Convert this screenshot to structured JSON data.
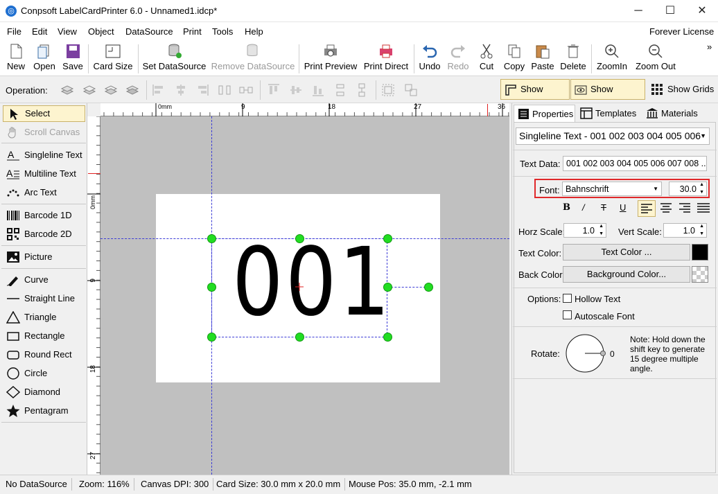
{
  "window": {
    "title": "Conpsoft LabelCardPrinter 6.0 - Unnamed1.idcp*",
    "minimize": "─",
    "maximize": "☐",
    "close": "✕"
  },
  "menu": {
    "items": [
      "File",
      "Edit",
      "View",
      "Object",
      "DataSource",
      "Print",
      "Tools",
      "Help"
    ],
    "license": "Forever License"
  },
  "toolbar": {
    "new": "New",
    "open": "Open",
    "save": "Save",
    "card_size": "Card Size",
    "set_ds": "Set DataSource",
    "remove_ds": "Remove DataSource",
    "print_preview": "Print Preview",
    "print_direct": "Print Direct",
    "undo": "Undo",
    "redo": "Redo",
    "cut": "Cut",
    "copy": "Copy",
    "paste": "Paste",
    "delete": "Delete",
    "zoom_in": "ZoomIn",
    "zoom_out": "Zoom Out",
    "overflow": "»"
  },
  "opbar": {
    "label": "Operation:",
    "show_ruler": "Show Ruler",
    "show_guides": "Show Guides",
    "show_grids": "Show Grids"
  },
  "tools": {
    "select": "Select",
    "scroll": "Scroll Canvas",
    "single": "Singleline Text",
    "multi": "Multiline Text",
    "arc": "Arc Text",
    "bc1": "Barcode 1D",
    "bc2": "Barcode 2D",
    "picture": "Picture",
    "curve": "Curve",
    "line": "Straight Line",
    "triangle": "Triangle",
    "rectangle": "Rectangle",
    "roundrect": "Round Rect",
    "circle": "Circle",
    "diamond": "Diamond",
    "pentagram": "Pentagram"
  },
  "ruler": {
    "h": [
      "0mm",
      "9",
      "18",
      "27",
      "36"
    ],
    "v": [
      "0mm",
      "9",
      "18",
      "27"
    ]
  },
  "canvas": {
    "text": "001"
  },
  "panel": {
    "tabs": {
      "properties": "Properties",
      "templates": "Templates",
      "materials": "Materials"
    },
    "object_select": "Singleline Text - 001 002 003 004 005 006",
    "text_data_label": "Text Data:",
    "text_data": "001 002 003 004 005 006 007 008 ...",
    "font_label": "Font:",
    "font": "Bahnschrift",
    "font_size": "30.0",
    "horz_label": "Horz Scale:",
    "horz": "1.0",
    "vert_label": "Vert Scale:",
    "vert": "1.0",
    "text_color_label": "Text Color:",
    "text_color_btn": "Text Color ...",
    "text_color": "#000000",
    "back_color_label": "Back Color:",
    "back_color_btn": "Background Color...",
    "options_label": "Options:",
    "hollow": "Hollow Text",
    "autoscale": "Autoscale Font",
    "rotate_label": "Rotate:",
    "rotate_value": "0",
    "note": "Note: Hold down the shift key to generate 15 degree multiple angle."
  },
  "status": {
    "ds": "No DataSource",
    "zoom": "Zoom: 116%",
    "dpi": "Canvas DPI: 300",
    "card": "Card Size: 30.0 mm x 20.0 mm",
    "mouse": "Mouse Pos: 35.0 mm, -2.1 mm"
  }
}
